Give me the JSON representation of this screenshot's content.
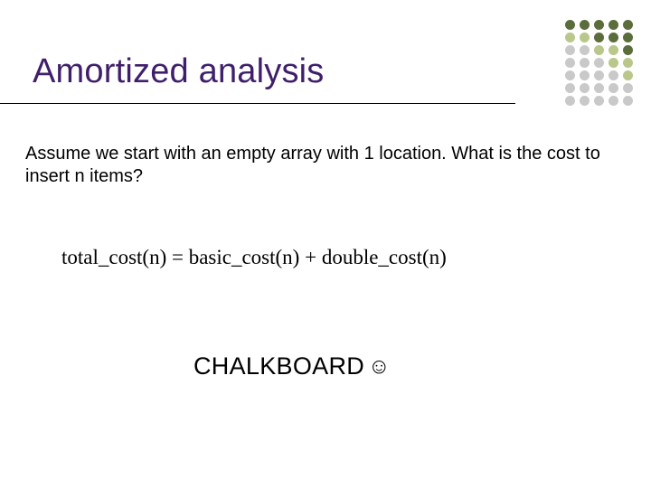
{
  "title": "Amortized analysis",
  "body": "Assume we start with an empty array with 1 location.  What is the cost to insert n items?",
  "equation": "total_cost(n) = basic_cost(n) + double_cost(n)",
  "chalkboard": "CHALKBOARD",
  "smiley": "☺",
  "deco_colors": {
    "dark": "#5a6d3b",
    "light": "#b9c78a",
    "gray": "#c9c9c9"
  }
}
